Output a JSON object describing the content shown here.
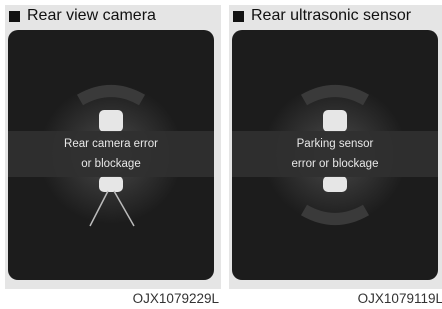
{
  "panels": [
    {
      "title": "Rear view camera",
      "message_line1": "Rear camera error",
      "message_line2": "or blockage",
      "figure_code": "OJX1079229L"
    },
    {
      "title": "Rear ultrasonic sensor",
      "message_line1": "Parking sensor",
      "message_line2": "error or blockage",
      "figure_code": "OJX1079119L"
    }
  ],
  "colors": {
    "screen_background": "#1c1c1c",
    "header_background": "#e5e5e5",
    "text_light": "#e8e8e8"
  }
}
